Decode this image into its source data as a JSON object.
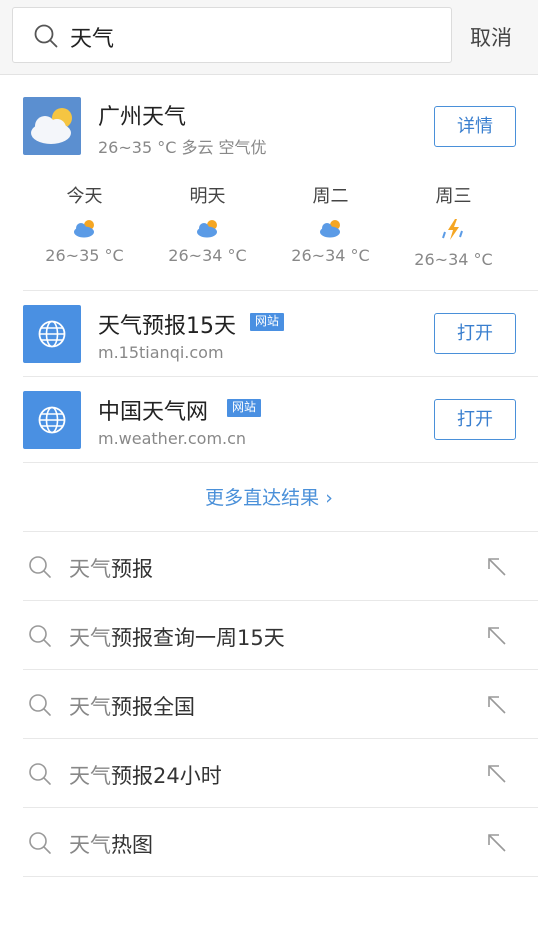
{
  "search": {
    "query": "天气",
    "cancel_label": "取消"
  },
  "weather": {
    "title": "广州天气",
    "summary": "26~35 °C  多云 空气优",
    "detail_label": "详情",
    "icon": "cloud-sun-icon",
    "forecast": [
      {
        "day": "今天",
        "temp": "26~35 °C",
        "icon": "cloud-sun-icon"
      },
      {
        "day": "明天",
        "temp": "26~34 °C",
        "icon": "cloud-sun-icon"
      },
      {
        "day": "周二",
        "temp": "26~34 °C",
        "icon": "cloud-sun-icon"
      },
      {
        "day": "周三",
        "temp": "26~34 °C",
        "icon": "thunder-rain-icon"
      }
    ]
  },
  "sites": [
    {
      "name": "天气预报15天",
      "tag": "网站",
      "url": "m.15tianqi.com",
      "open_label": "打开",
      "icon": "globe-icon"
    },
    {
      "name": "中国天气网",
      "tag": "网站",
      "url": "m.weather.com.cn",
      "open_label": "打开",
      "icon": "globe-icon"
    }
  ],
  "more_results": "更多直达结果  ›",
  "suggestions": [
    {
      "prefix": "天气",
      "rest": "预报"
    },
    {
      "prefix": "天气",
      "rest": "预报查询一周15天"
    },
    {
      "prefix": "天气",
      "rest": "预报全国"
    },
    {
      "prefix": "天气",
      "rest": "预报24小时"
    },
    {
      "prefix": "天气",
      "rest": "热图"
    }
  ],
  "colors": {
    "accent": "#4a90d9",
    "site_icon_bg": "#4a90e2",
    "weather_icon_bg": "#5b8fd0"
  }
}
